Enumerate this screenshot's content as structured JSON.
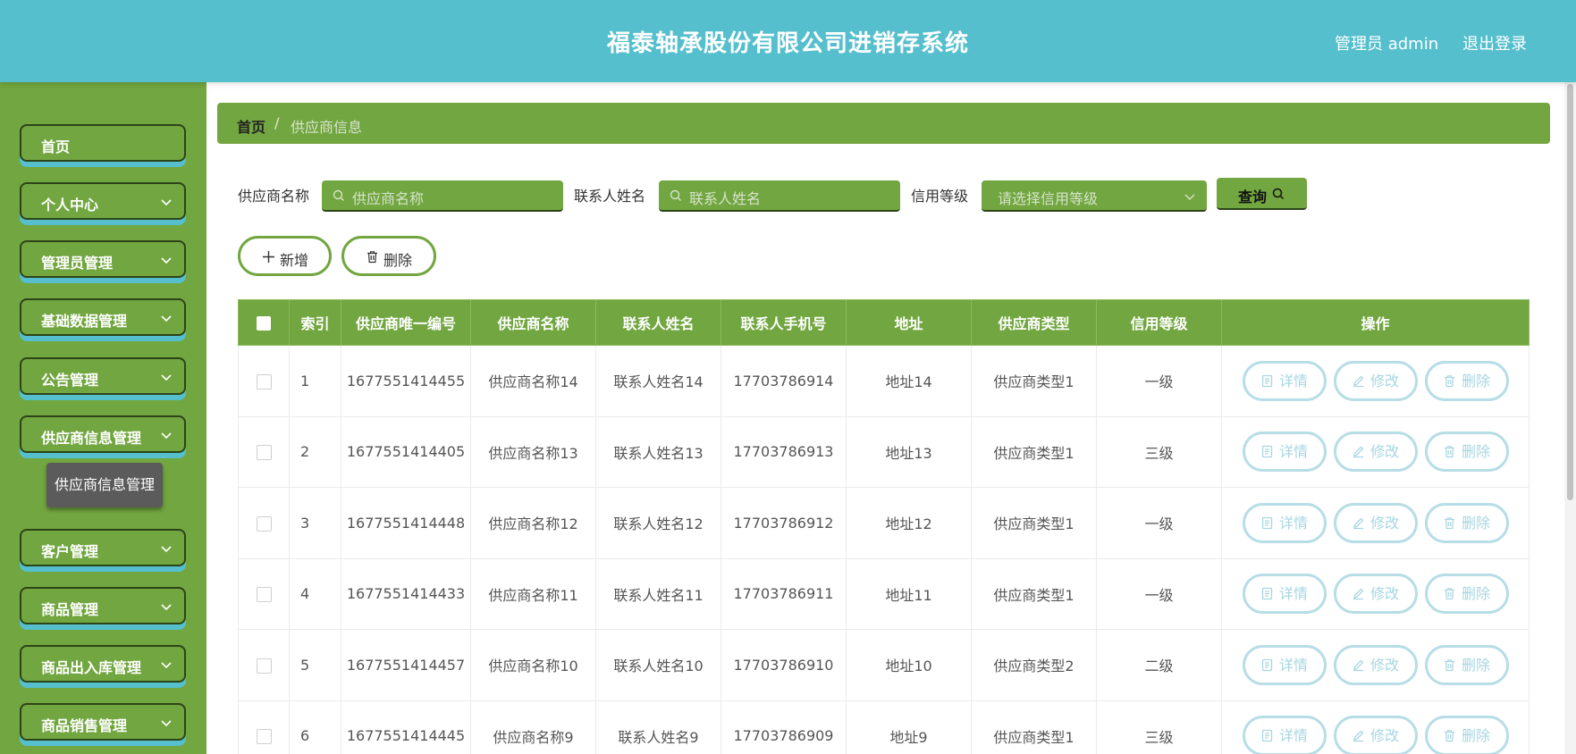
{
  "header": {
    "title": "福泰轴承股份有限公司进销存系统",
    "user": "管理员 admin",
    "logout": "退出登录"
  },
  "sidebar": {
    "items": [
      {
        "label": "首页"
      },
      {
        "label": "个人中心"
      },
      {
        "label": "管理员管理"
      },
      {
        "label": "基础数据管理"
      },
      {
        "label": "公告管理"
      },
      {
        "label": "供应商信息管理"
      },
      {
        "label": "客户管理"
      },
      {
        "label": "商品管理"
      },
      {
        "label": "商品出入库管理"
      },
      {
        "label": "商品销售管理"
      }
    ],
    "sub_item": "供应商信息管理"
  },
  "breadcrumb": {
    "home": "首页",
    "separator": "/",
    "current": "供应商信息"
  },
  "search": {
    "name_label": "供应商名称",
    "name_placeholder": "供应商名称",
    "contact_label": "联系人姓名",
    "contact_placeholder": "联系人姓名",
    "credit_label": "信用等级",
    "credit_placeholder": "请选择信用等级",
    "query_button": "查询"
  },
  "actions": {
    "add": "新增",
    "delete": "删除"
  },
  "table": {
    "headers": [
      "索引",
      "供应商唯一编号",
      "供应商名称",
      "联系人姓名",
      "联系人手机号",
      "地址",
      "供应商类型",
      "信用等级",
      "操作"
    ],
    "op_labels": {
      "detail": "详情",
      "edit": "修改",
      "delete": "删除"
    },
    "rows": [
      [
        "1",
        "1677551414455",
        "供应商名称14",
        "联系人姓名14",
        "17703786914",
        "地址14",
        "供应商类型1",
        "一级"
      ],
      [
        "2",
        "1677551414405",
        "供应商名称13",
        "联系人姓名13",
        "17703786913",
        "地址13",
        "供应商类型1",
        "三级"
      ],
      [
        "3",
        "1677551414448",
        "供应商名称12",
        "联系人姓名12",
        "17703786912",
        "地址12",
        "供应商类型1",
        "一级"
      ],
      [
        "4",
        "1677551414433",
        "供应商名称11",
        "联系人姓名11",
        "17703786911",
        "地址11",
        "供应商类型1",
        "一级"
      ],
      [
        "5",
        "1677551414457",
        "供应商名称10",
        "联系人姓名10",
        "17703786910",
        "地址10",
        "供应商类型2",
        "二级"
      ],
      [
        "6",
        "1677551414445",
        "供应商名称9",
        "联系人姓名9",
        "17703786909",
        "地址9",
        "供应商类型1",
        "三级"
      ]
    ]
  },
  "colors": {
    "header": "#55bfcd",
    "accent": "#72a640",
    "op_button": "#b7dde6"
  }
}
